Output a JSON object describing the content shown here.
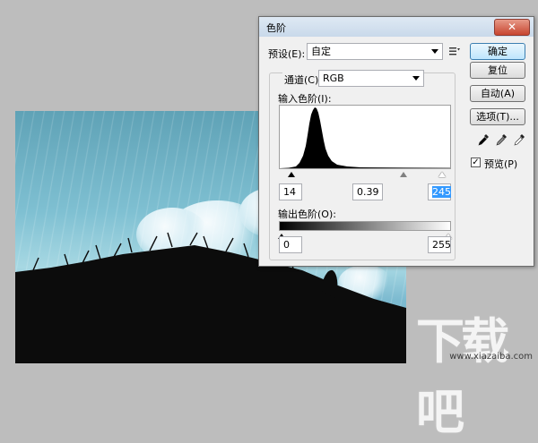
{
  "dialog": {
    "title": "色阶",
    "close_label": "✕",
    "preset_label": "预设(E):",
    "preset_value": "自定",
    "channel_label": "通道(C):",
    "channel_value": "RGB",
    "input_levels_label": "输入色阶(I):",
    "input_black": "14",
    "input_gamma": "0.39",
    "input_white": "245",
    "output_levels_label": "输出色阶(O):",
    "output_black": "0",
    "output_white": "255",
    "buttons": {
      "ok": "确定",
      "reset": "复位",
      "auto": "自动(A)",
      "options": "选项(T)..."
    },
    "preview_label": "预览(P)",
    "preview_checked": "✓",
    "icons": [
      "preset-options-icon",
      "black-eyedropper-icon",
      "gray-eyedropper-icon",
      "white-eyedropper-icon"
    ]
  },
  "watermark": {
    "logo": "下载吧",
    "url": "www.xiazaiba.com"
  },
  "colors": {
    "sky": "#7fc0d2",
    "ok_button_border": "#3c7fb1",
    "close_button": "#c7452f"
  }
}
